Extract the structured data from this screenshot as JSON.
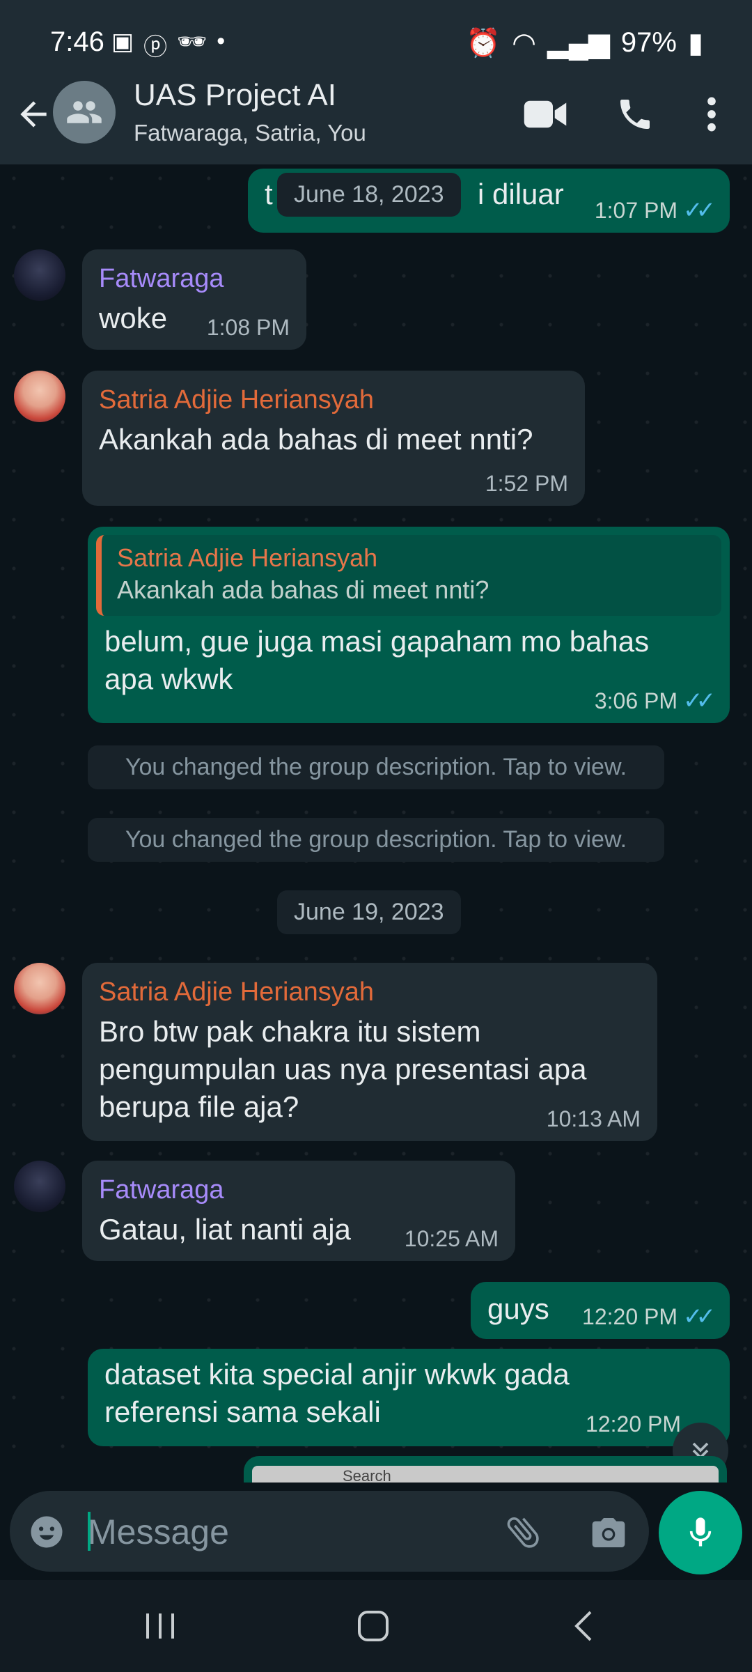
{
  "status_bar": {
    "time": "7:46",
    "battery": "97%"
  },
  "header": {
    "title": "UAS Project AI",
    "subtitle": "Fatwaraga, Satria, You"
  },
  "messages": {
    "m0": {
      "text_left": "t",
      "text_right": "i diluar",
      "time": "1:07 PM"
    },
    "date1": "June 18, 2023",
    "m1": {
      "sender": "Fatwaraga",
      "text": "woke",
      "time": "1:08 PM"
    },
    "m2": {
      "sender": "Satria Adjie Heriansyah",
      "text": "Akankah ada bahas di meet nnti?",
      "time": "1:52 PM"
    },
    "m3": {
      "quote_sender": "Satria Adjie Heriansyah",
      "quote_text": "Akankah ada bahas di meet nnti?",
      "text": "belum, gue juga masi gapaham mo bahas apa wkwk",
      "time": "3:06 PM"
    },
    "sys1": "You changed the group description. Tap to view.",
    "sys2": "You changed the group description. Tap to view.",
    "date2": "June 19, 2023",
    "m4": {
      "sender": "Satria Adjie Heriansyah",
      "text": "Bro btw pak chakra itu sistem pengumpulan uas nya presentasi apa berupa file aja?",
      "time": "10:13 AM"
    },
    "m5": {
      "sender": "Fatwaraga",
      "text": "Gatau, liat nanti aja",
      "time": "10:25 AM"
    },
    "m6": {
      "text": "guys",
      "time": "12:20 PM"
    },
    "m7": {
      "text": "dataset kita special anjir wkwk gada referensi sama sekali",
      "time": "12:20 PM"
    },
    "m8_preview_search": "Search"
  },
  "input": {
    "placeholder": "Message"
  },
  "colors": {
    "accent": "#00a884",
    "outgoing": "#005c4b",
    "incoming": "#202c33",
    "fatwaraga": "#a78bfa",
    "satria": "#e26a3a",
    "read_ticks": "#53bdeb"
  }
}
